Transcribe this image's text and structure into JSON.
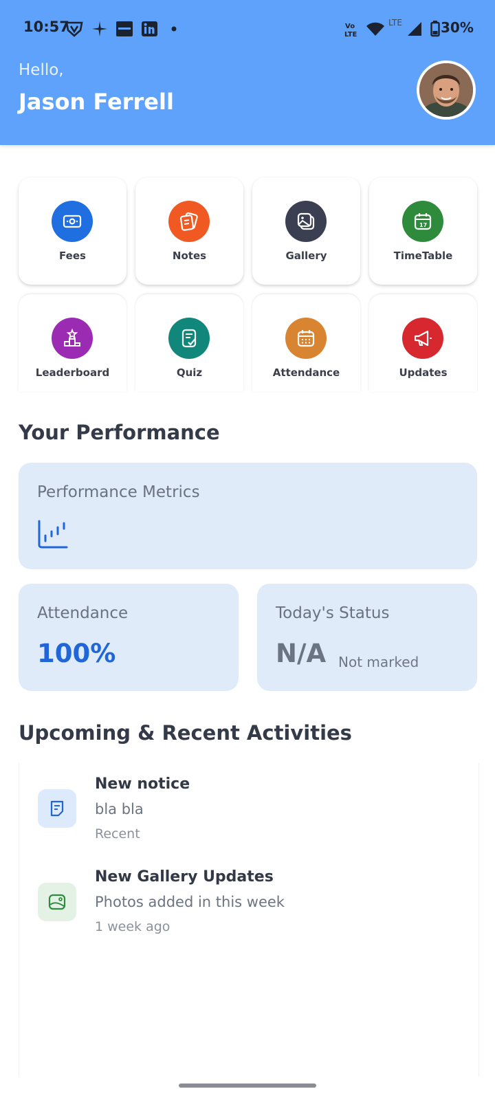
{
  "status_bar": {
    "time": "10:57",
    "battery": "30%"
  },
  "header": {
    "greeting": "Hello,",
    "user_name": "Jason Ferrell"
  },
  "menu": [
    {
      "label": "Fees",
      "icon": "wallet-icon",
      "color": "#1f6fe0"
    },
    {
      "label": "Notes",
      "icon": "notes-icon",
      "color": "#f05a22"
    },
    {
      "label": "Gallery",
      "icon": "gallery-icon",
      "color": "#3a3f52"
    },
    {
      "label": "TimeTable",
      "icon": "calendar-icon",
      "color": "#2e8b3c"
    },
    {
      "label": "Leaderboard",
      "icon": "podium-icon",
      "color": "#9c2bb3"
    },
    {
      "label": "Quiz",
      "icon": "quiz-icon",
      "color": "#10877a"
    },
    {
      "label": "Attendance",
      "icon": "attendance-calendar-icon",
      "color": "#d88431"
    },
    {
      "label": "Updates",
      "icon": "megaphone-icon",
      "color": "#d7282f"
    }
  ],
  "performance": {
    "section_title": "Your Performance",
    "metrics_title": "Performance Metrics",
    "attendance_label": "Attendance",
    "attendance_value": "100%",
    "status_label": "Today's Status",
    "status_value": "N/A",
    "status_note": "Not marked"
  },
  "activities": {
    "section_title": "Upcoming & Recent Activities",
    "items": [
      {
        "title": "New notice",
        "subtitle": "bla bla",
        "time": "Recent",
        "icon": "notice-icon"
      },
      {
        "title": "New Gallery Updates",
        "subtitle": "Photos added in this week",
        "time": "1 week ago",
        "icon": "gallery-update-icon"
      }
    ]
  }
}
